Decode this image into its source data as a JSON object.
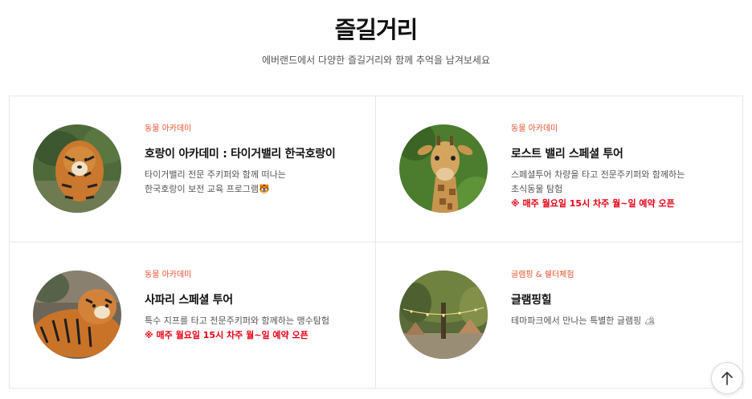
{
  "header": {
    "title": "즐길거리",
    "subtitle": "에버랜드에서 다양한 즐길거리와 함께 추억을 남겨보세요"
  },
  "cards": [
    {
      "category": "동물 아카데미",
      "title": "호랑이 아카데미 : 타이거밸리 한국호랑이",
      "desc": [
        "타이거밸리 전문 주키퍼와 함께 떠나는",
        "한국호랑이 보전 교육 프로그램🐯"
      ],
      "notice": "",
      "image_icon": "tiger-photo"
    },
    {
      "category": "동물 아카데미",
      "title": "로스트 밸리 스페셜 투어",
      "desc": [
        "스페셜투어 차량을 타고 전문주키퍼와 함께하는",
        "초식동물 탐험"
      ],
      "notice": "※ 매주 월요일 15시 차주 월~일 예약 오픈",
      "image_icon": "giraffe-photo"
    },
    {
      "category": "동물 아카데미",
      "title": "사파리 스페셜 투어",
      "desc": [
        "특수 지프를 타고 전문주키퍼와 함께하는 맹수탐험"
      ],
      "notice": "※ 매주 월요일 15시 차주 월~일 예약 오픈",
      "image_icon": "tiger-lying-photo"
    },
    {
      "category": "글램핑 & 쉘터체험",
      "title": "글램핑힐",
      "desc": [
        "테마파크에서 만나는 특별한 글램핑 🏕"
      ],
      "notice": "",
      "image_icon": "glamping-photo"
    }
  ],
  "colors": {
    "accent": "#e8502e",
    "notice": "#e60012",
    "border": "#e7e7e7"
  },
  "top_button": {
    "icon": "arrow-up-icon"
  }
}
